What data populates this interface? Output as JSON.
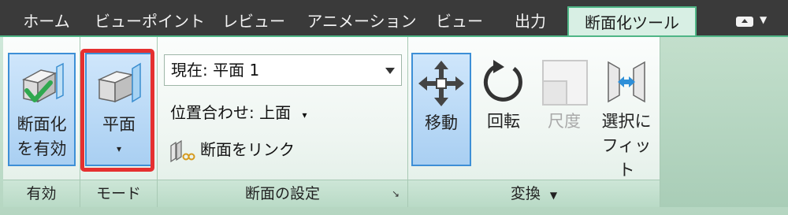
{
  "tabs": [
    {
      "label": "ホーム"
    },
    {
      "label": "ビューポイント"
    },
    {
      "label": "レビュー"
    },
    {
      "label": "アニメーション"
    },
    {
      "label": "ビュー"
    },
    {
      "label": "出力"
    },
    {
      "label": "断面化ツール",
      "active": true
    }
  ],
  "ribbon": {
    "enable_group": {
      "label": "有効",
      "button_label_1": "断面化",
      "button_label_2": "を有効"
    },
    "mode_group": {
      "label": "モード",
      "button_label": "平面",
      "dropdown_arrow": "▾"
    },
    "settings_group": {
      "label": "断面の設定",
      "current_plane": "現在: 平面 1",
      "align_label": "位置合わせ: 上面",
      "align_arrow": "▾",
      "link_label": "断面をリンク",
      "launcher": "↘"
    },
    "transform_group": {
      "label": "変換",
      "label_arrow": "▼",
      "move_label": "移動",
      "rotate_label": "回転",
      "scale_label": "尺度",
      "fit_label_1": "選択に",
      "fit_label_2": "フィット"
    }
  },
  "colors": {
    "accent": "#4fb586",
    "selected_border": "#3d8fd6",
    "highlight": "#e53030"
  }
}
